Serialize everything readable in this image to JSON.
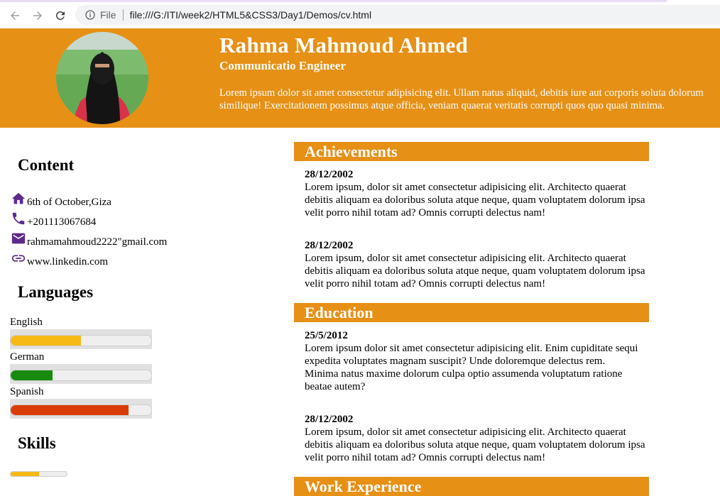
{
  "browser": {
    "scheme_label": "File",
    "url": "file:///G:/ITI/week2/HTML5&CSS3/Day1/Demos/cv.html"
  },
  "header": {
    "name": "Rahma Mahmoud Ahmed",
    "job_title": "Communicatio Engineer",
    "intro": "Lorem ipsum dolor sit amet consectetur adipisicing elit. Ullam natus aliquid, debitis iure aut corporis soluta dolorum similique! Exercitationem possimus atque officia, veniam quaerat veritatis corrupti quos quo quasi minima."
  },
  "contact": {
    "title": "Content",
    "items": [
      {
        "icon": "home-icon",
        "text": "6th of October,Giza"
      },
      {
        "icon": "phone-icon",
        "text": "+201113067684"
      },
      {
        "icon": "email-icon",
        "text": "rahmamahmoud2222\"gmail.com"
      },
      {
        "icon": "link-icon",
        "text": "www.linkedin.com"
      }
    ],
    "icon_color": "#5e2a8c"
  },
  "languages": {
    "title": "Languages",
    "items": [
      {
        "name": "English",
        "level": 0.5,
        "color": "#f7b916"
      },
      {
        "name": "German",
        "level": 0.3,
        "color": "#178a0f"
      },
      {
        "name": "Spanish",
        "level": 0.84,
        "color": "#d93d05"
      }
    ]
  },
  "skills": {
    "title": "Skills",
    "items": [
      {
        "level": 0.5,
        "color": "#f7b916"
      }
    ]
  },
  "achievements": {
    "title": "Achievements",
    "entries": [
      {
        "date": "28/12/2002",
        "text": "Lorem ipsum, dolor sit amet consectetur adipisicing elit. Architecto quaerat debitis aliquam ea doloribus soluta atque neque, quam voluptatem dolorum ipsa velit porro nihil totam ad? Omnis corrupti delectus nam!"
      },
      {
        "date": "28/12/2002",
        "text": "Lorem ipsum, dolor sit amet consectetur adipisicing elit. Architecto quaerat debitis aliquam ea doloribus soluta atque neque, quam voluptatem dolorum ipsa velit porro nihil totam ad? Omnis corrupti delectus nam!"
      }
    ]
  },
  "education": {
    "title": "Education",
    "entries": [
      {
        "date": "25/5/2012",
        "text": "Lorem ipsum dolor sit amet consectetur adipisicing elit. Enim cupiditate sequi expedita voluptates magnam suscipit? Unde doloremque delectus rem. Minima natus maxime dolorum culpa optio assumenda voluptatum ratione beatae autem?"
      },
      {
        "date": "28/12/2002",
        "text": "Lorem ipsum, dolor sit amet consectetur adipisicing elit. Architecto quaerat debitis aliquam ea doloribus soluta atque neque, quam voluptatem dolorum ipsa velit porro nihil totam ad? Omnis corrupti delectus nam!"
      }
    ]
  },
  "work": {
    "title": "Work Experience"
  },
  "colors": {
    "accent": "#e69016",
    "icon": "#5e2a8c"
  }
}
